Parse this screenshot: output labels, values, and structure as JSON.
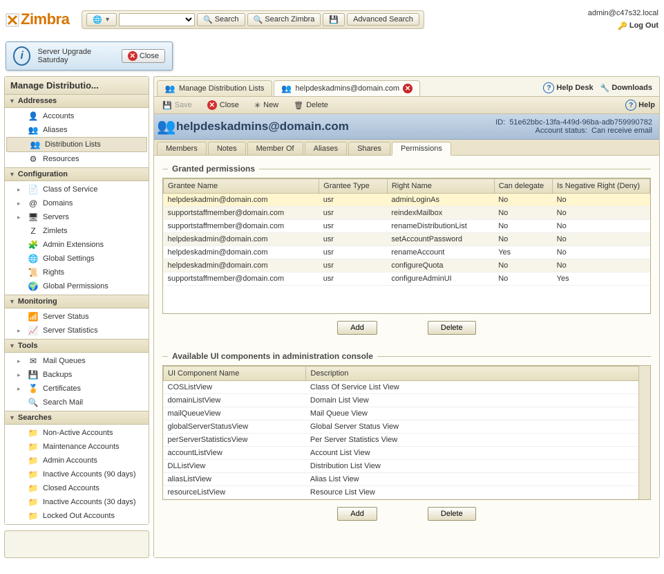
{
  "logo": "Zimbra",
  "topbar": {
    "search_label": "Search",
    "search_zimbra_label": "Search Zimbra",
    "advanced_search_label": "Advanced Search"
  },
  "user": {
    "email": "admin@c47s32.local",
    "logout_label": "Log Out"
  },
  "notice": {
    "text": "Server Upgrade Saturday",
    "close_label": "Close"
  },
  "sidebar": {
    "title": "Manage Distributio...",
    "groups": [
      {
        "label": "Addresses",
        "items": [
          {
            "label": "Accounts",
            "icon": "👤"
          },
          {
            "label": "Aliases",
            "icon": "👥"
          },
          {
            "label": "Distribution Lists",
            "icon": "👥",
            "sel": true
          },
          {
            "label": "Resources",
            "icon": "⚙"
          }
        ]
      },
      {
        "label": "Configuration",
        "items": [
          {
            "label": "Class of Service",
            "icon": "📄",
            "exp": true
          },
          {
            "label": "Domains",
            "icon": "@",
            "exp": true
          },
          {
            "label": "Servers",
            "icon": "🖥",
            "exp": true
          },
          {
            "label": "Zimlets",
            "icon": "Z"
          },
          {
            "label": "Admin Extensions",
            "icon": "🧩"
          },
          {
            "label": "Global Settings",
            "icon": "🌐"
          },
          {
            "label": "Rights",
            "icon": "📜"
          },
          {
            "label": "Global Permissions",
            "icon": "🌍"
          }
        ]
      },
      {
        "label": "Monitoring",
        "items": [
          {
            "label": "Server Status",
            "icon": "📶"
          },
          {
            "label": "Server Statistics",
            "icon": "📈",
            "exp": true
          }
        ]
      },
      {
        "label": "Tools",
        "items": [
          {
            "label": "Mail Queues",
            "icon": "✉",
            "exp": true
          },
          {
            "label": "Backups",
            "icon": "💾",
            "exp": true
          },
          {
            "label": "Certificates",
            "icon": "🏅",
            "exp": true
          },
          {
            "label": "Search Mail",
            "icon": "🔍"
          }
        ]
      },
      {
        "label": "Searches",
        "items": [
          {
            "label": "Non-Active Accounts",
            "icon": "📁"
          },
          {
            "label": "Maintenance Accounts",
            "icon": "📁"
          },
          {
            "label": "Admin Accounts",
            "icon": "📁"
          },
          {
            "label": "Inactive Accounts (90 days)",
            "icon": "📁"
          },
          {
            "label": "Closed Accounts",
            "icon": "📁"
          },
          {
            "label": "Inactive Accounts (30 days)",
            "icon": "📁"
          },
          {
            "label": "Locked Out Accounts",
            "icon": "📁"
          }
        ]
      }
    ]
  },
  "tabs": [
    {
      "label": "Manage Distribution Lists",
      "icon": "👥"
    },
    {
      "label": "helpdeskadmins@domain.com",
      "icon": "👥",
      "closable": true,
      "active": true
    }
  ],
  "tabright": {
    "helpdesk": "Help Desk",
    "downloads": "Downloads"
  },
  "toolbar2": {
    "save": "Save",
    "close": "Close",
    "new": "New",
    "delete": "Delete",
    "help": "Help"
  },
  "header": {
    "title": "helpdeskadmins@domain.com",
    "id_label": "ID:",
    "id": "51e62bbc-13fa-449d-96ba-adb759990782",
    "status_label": "Account status:",
    "status": "Can receive email"
  },
  "subtabs": [
    "Members",
    "Notes",
    "Member Of",
    "Aliases",
    "Shares",
    "Permissions"
  ],
  "subtab_active": 5,
  "section1": {
    "title": "Granted permissions",
    "columns": [
      "Grantee Name",
      "Grantee Type",
      "Right Name",
      "Can delegate",
      "Is Negative Right (Deny)"
    ],
    "rows": [
      [
        "helpdeskadmin@domain.com",
        "usr",
        "adminLoginAs",
        "No",
        "No"
      ],
      [
        "supportstaffmember@domain.com",
        "usr",
        "reindexMailbox",
        "No",
        "No"
      ],
      [
        "supportstaffmember@domain.com",
        "usr",
        "renameDistributionList",
        "No",
        "No"
      ],
      [
        "helpdeskadmin@domain.com",
        "usr",
        "setAccountPassword",
        "No",
        "No"
      ],
      [
        "helpdeskadmin@domain.com",
        "usr",
        "renameAccount",
        "Yes",
        "No"
      ],
      [
        "helpdeskadmin@domain.com",
        "usr",
        "configureQuota",
        "No",
        "No"
      ],
      [
        "supportstaffmember@domain.com",
        "usr",
        "configureAdminUI",
        "No",
        "Yes"
      ]
    ],
    "add": "Add",
    "delete": "Delete"
  },
  "section2": {
    "title": "Available UI components in administration console",
    "columns": [
      "UI Component Name",
      "Description"
    ],
    "rows": [
      [
        "COSListView",
        "Class Of Service List View"
      ],
      [
        "domainListView",
        "Domain List View"
      ],
      [
        "mailQueueView",
        "Mail Queue View"
      ],
      [
        "globalServerStatusView",
        "Global Server Status View"
      ],
      [
        "perServerStatisticsView",
        "Per Server Statistics View"
      ],
      [
        "accountListView",
        "Account List View"
      ],
      [
        "DLListView",
        "Distribution List View"
      ],
      [
        "aliasListView",
        "Alias List View"
      ],
      [
        "resourceListView",
        "Resource List View"
      ]
    ],
    "add": "Add",
    "delete": "Delete"
  }
}
